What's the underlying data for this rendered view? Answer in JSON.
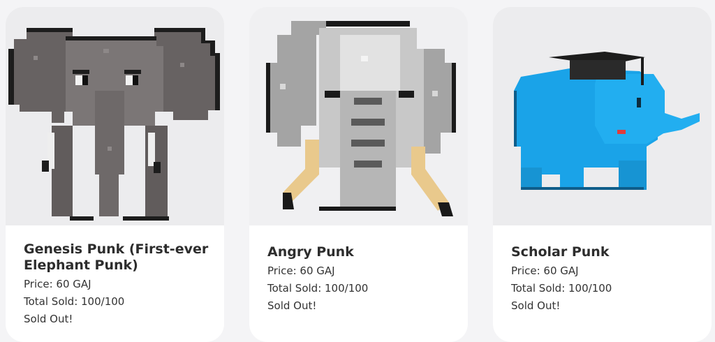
{
  "cards": [
    {
      "title": "Genesis Punk (First-ever Elephant Punk)",
      "price": "Price: 60 GAJ",
      "sold": "Total Sold: 100/100",
      "status": "Sold Out!",
      "image_icon": "gray-pixel-elephant-icon"
    },
    {
      "title": "Angry Punk",
      "price": "Price: 60 GAJ",
      "sold": "Total Sold: 100/100",
      "status": "Sold Out!",
      "image_icon": "angry-pixel-elephant-icon"
    },
    {
      "title": "Scholar Punk",
      "price": "Price: 60 GAJ",
      "sold": "Total Sold: 100/100",
      "status": "Sold Out!",
      "image_icon": "blue-graduate-elephant-icon"
    }
  ],
  "colors": {
    "page_bg": "#f4f4f6",
    "card_bg": "#ffffff",
    "text": "#2d2d2d",
    "genesis_body": "#6f6a6a",
    "angry_body": "#9c9c9c",
    "scholar_body": "#1aa3e8"
  }
}
